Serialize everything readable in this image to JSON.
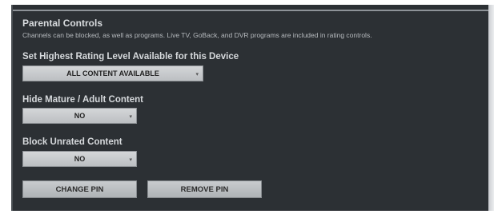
{
  "section": {
    "title": "Parental Controls",
    "description": "Channels can be blocked, as well as programs. Live TV, GoBack, and DVR programs are included in rating controls."
  },
  "rating_level": {
    "label": "Set Highest Rating Level Available for this Device",
    "selected": "ALL CONTENT AVAILABLE"
  },
  "mature_content": {
    "label": "Hide Mature / Adult Content",
    "selected": "NO"
  },
  "unrated_content": {
    "label": "Block Unrated Content",
    "selected": "NO"
  },
  "buttons": {
    "change_pin": "CHANGE PIN",
    "remove_pin": "REMOVE PIN"
  },
  "icons": {
    "dropdown": "chevron-down-icon"
  }
}
